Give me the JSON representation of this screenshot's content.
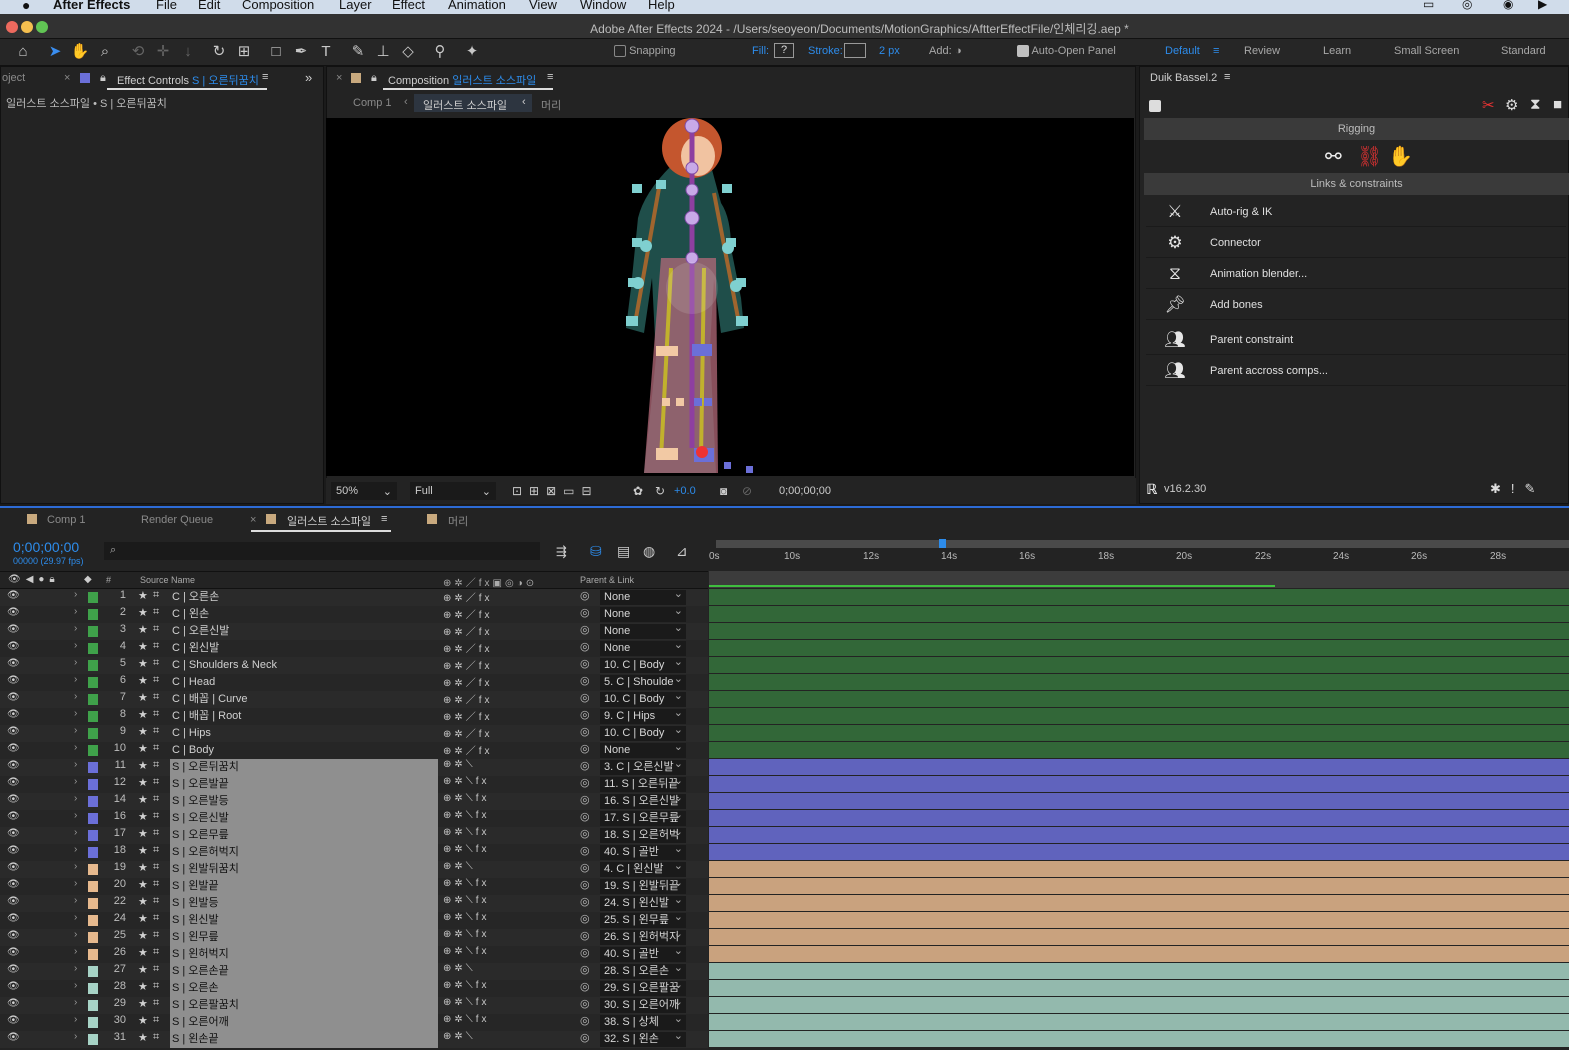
{
  "menubar": {
    "app": "After Effects",
    "items": [
      "File",
      "Edit",
      "Composition",
      "Layer",
      "Effect",
      "Animation",
      "View",
      "Window",
      "Help"
    ]
  },
  "window": {
    "title": "Adobe After Effects 2024 - /Users/seoyeon/Documents/MotionGraphics/AftterEffectFile/인체리깅.aep *"
  },
  "toolbar": {
    "snapping": "Snapping",
    "fill": "Fill:",
    "fill_value": "?",
    "stroke": "Stroke:",
    "stroke_px": "2 px",
    "add": "Add:",
    "auto_open": "Auto-Open Panel",
    "workspaces": [
      "Default",
      "Review",
      "Learn",
      "Small Screen",
      "Standard"
    ]
  },
  "left_panel": {
    "tab_project": "oject",
    "tab_effect": "Effect Controls",
    "tab_effect_layer": "S | 오른뒤꿈치",
    "subtitle": "일러스트 소스파일 • S | 오른뒤꿈치"
  },
  "comp_panel": {
    "tab": "Composition",
    "tab_name": "일러스트 소스파일",
    "crumbs": [
      "Comp 1",
      "일러스트 소스파일",
      "머리"
    ],
    "zoom": "50%",
    "resolution": "Full",
    "exposure": "+0.0",
    "timecode": "0;00;00;00"
  },
  "duik": {
    "title": "Duik Bassel.2",
    "section_rigging": "Rigging",
    "section_links": "Links & constraints",
    "items": [
      {
        "label": "Auto-rig & IK",
        "icon": "auto-rig-icon"
      },
      {
        "label": "Connector",
        "icon": "connector-icon"
      },
      {
        "label": "Animation blender...",
        "icon": "animation-blender-icon"
      },
      {
        "label": "Add bones",
        "icon": "add-bones-icon"
      },
      {
        "label": "Parent constraint",
        "icon": "parent-constraint-icon"
      },
      {
        "label": "Parent accross comps...",
        "icon": "parent-comps-icon"
      }
    ],
    "version": "v16.2.30"
  },
  "timeline": {
    "tabs": [
      "Comp 1",
      "Render Queue",
      "일러스트 소스파일",
      "머리"
    ],
    "timecode": "0;00;00;00",
    "fps": "00000 (29.97 fps)",
    "col_source": "Source Name",
    "col_parent": "Parent & Link",
    "ruler": [
      "0s",
      "10s",
      "12s",
      "14s",
      "16s",
      "18s",
      "20s",
      "22s",
      "24s",
      "26s",
      "28s"
    ],
    "layers": [
      {
        "num": "1",
        "name": "C | 오른손",
        "parent": "None",
        "color": "#3fa14a",
        "type": "c"
      },
      {
        "num": "2",
        "name": "C | 왼손",
        "parent": "None",
        "color": "#3fa14a",
        "type": "c"
      },
      {
        "num": "3",
        "name": "C | 오른신발",
        "parent": "None",
        "color": "#3fa14a",
        "type": "c"
      },
      {
        "num": "4",
        "name": "C | 왼신발",
        "parent": "None",
        "color": "#3fa14a",
        "type": "c"
      },
      {
        "num": "5",
        "name": "C | Shoulders & Neck",
        "parent": "10. C | Body",
        "color": "#3fa14a",
        "type": "c"
      },
      {
        "num": "6",
        "name": "C | Head",
        "parent": "5. C | Shoulde",
        "color": "#3fa14a",
        "type": "c"
      },
      {
        "num": "7",
        "name": "C | 배꼽 | Curve",
        "parent": "10. C | Body",
        "color": "#3fa14a",
        "type": "c"
      },
      {
        "num": "8",
        "name": "C | 배꼽 | Root",
        "parent": "9. C | Hips",
        "color": "#3fa14a",
        "type": "c"
      },
      {
        "num": "9",
        "name": "C | Hips",
        "parent": "10. C | Body",
        "color": "#3fa14a",
        "type": "c"
      },
      {
        "num": "10",
        "name": "C | Body",
        "parent": "None",
        "color": "#3fa14a",
        "type": "c"
      },
      {
        "num": "11",
        "name": "S | 오른뒤꿈치",
        "parent": "3. C | 오른신발",
        "color": "#6b6fd8",
        "type": "s"
      },
      {
        "num": "12",
        "name": "S | 오른발끝",
        "parent": "11. S | 오른뒤끝",
        "color": "#6b6fd8",
        "type": "s"
      },
      {
        "num": "14",
        "name": "S | 오른발등",
        "parent": "16. S | 오른신발",
        "color": "#6b6fd8",
        "type": "s"
      },
      {
        "num": "16",
        "name": "S | 오른신발",
        "parent": "17. S | 오른무릎",
        "color": "#6b6fd8",
        "type": "s"
      },
      {
        "num": "17",
        "name": "S | 오른무릎",
        "parent": "18. S | 오른허벅",
        "color": "#6b6fd8",
        "type": "s"
      },
      {
        "num": "18",
        "name": "S | 오른허벅지",
        "parent": "40. S | 골반",
        "color": "#6b6fd8",
        "type": "s"
      },
      {
        "num": "19",
        "name": "S | 왼발뒤꿈치",
        "parent": "4. C | 왼신발",
        "color": "#e6b98e",
        "type": "s"
      },
      {
        "num": "20",
        "name": "S | 왼발끝",
        "parent": "19. S | 왼발뒤끝",
        "color": "#e6b98e",
        "type": "s"
      },
      {
        "num": "22",
        "name": "S | 왼발등",
        "parent": "24. S | 왼신발",
        "color": "#e6b98e",
        "type": "s"
      },
      {
        "num": "24",
        "name": "S | 왼신발",
        "parent": "25. S | 왼무릎",
        "color": "#e6b98e",
        "type": "s"
      },
      {
        "num": "25",
        "name": "S | 왼무릎",
        "parent": "26. S | 왼허벅지",
        "color": "#e6b98e",
        "type": "s"
      },
      {
        "num": "26",
        "name": "S | 왼허벅지",
        "parent": "40. S | 골반",
        "color": "#e6b98e",
        "type": "s"
      },
      {
        "num": "27",
        "name": "S | 오른손끝",
        "parent": "28. S | 오른손",
        "color": "#a7d3c6",
        "type": "s"
      },
      {
        "num": "28",
        "name": "S | 오른손",
        "parent": "29. S | 오른팔꿈",
        "color": "#a7d3c6",
        "type": "s"
      },
      {
        "num": "29",
        "name": "S | 오른팔꿈치",
        "parent": "30. S | 오른어깨",
        "color": "#a7d3c6",
        "type": "s"
      },
      {
        "num": "30",
        "name": "S | 오른어깨",
        "parent": "38. S | 상체",
        "color": "#a7d3c6",
        "type": "s"
      },
      {
        "num": "31",
        "name": "S | 왼손끝",
        "parent": "32. S | 왼손",
        "color": "#a7d3c6",
        "type": "s"
      }
    ]
  }
}
